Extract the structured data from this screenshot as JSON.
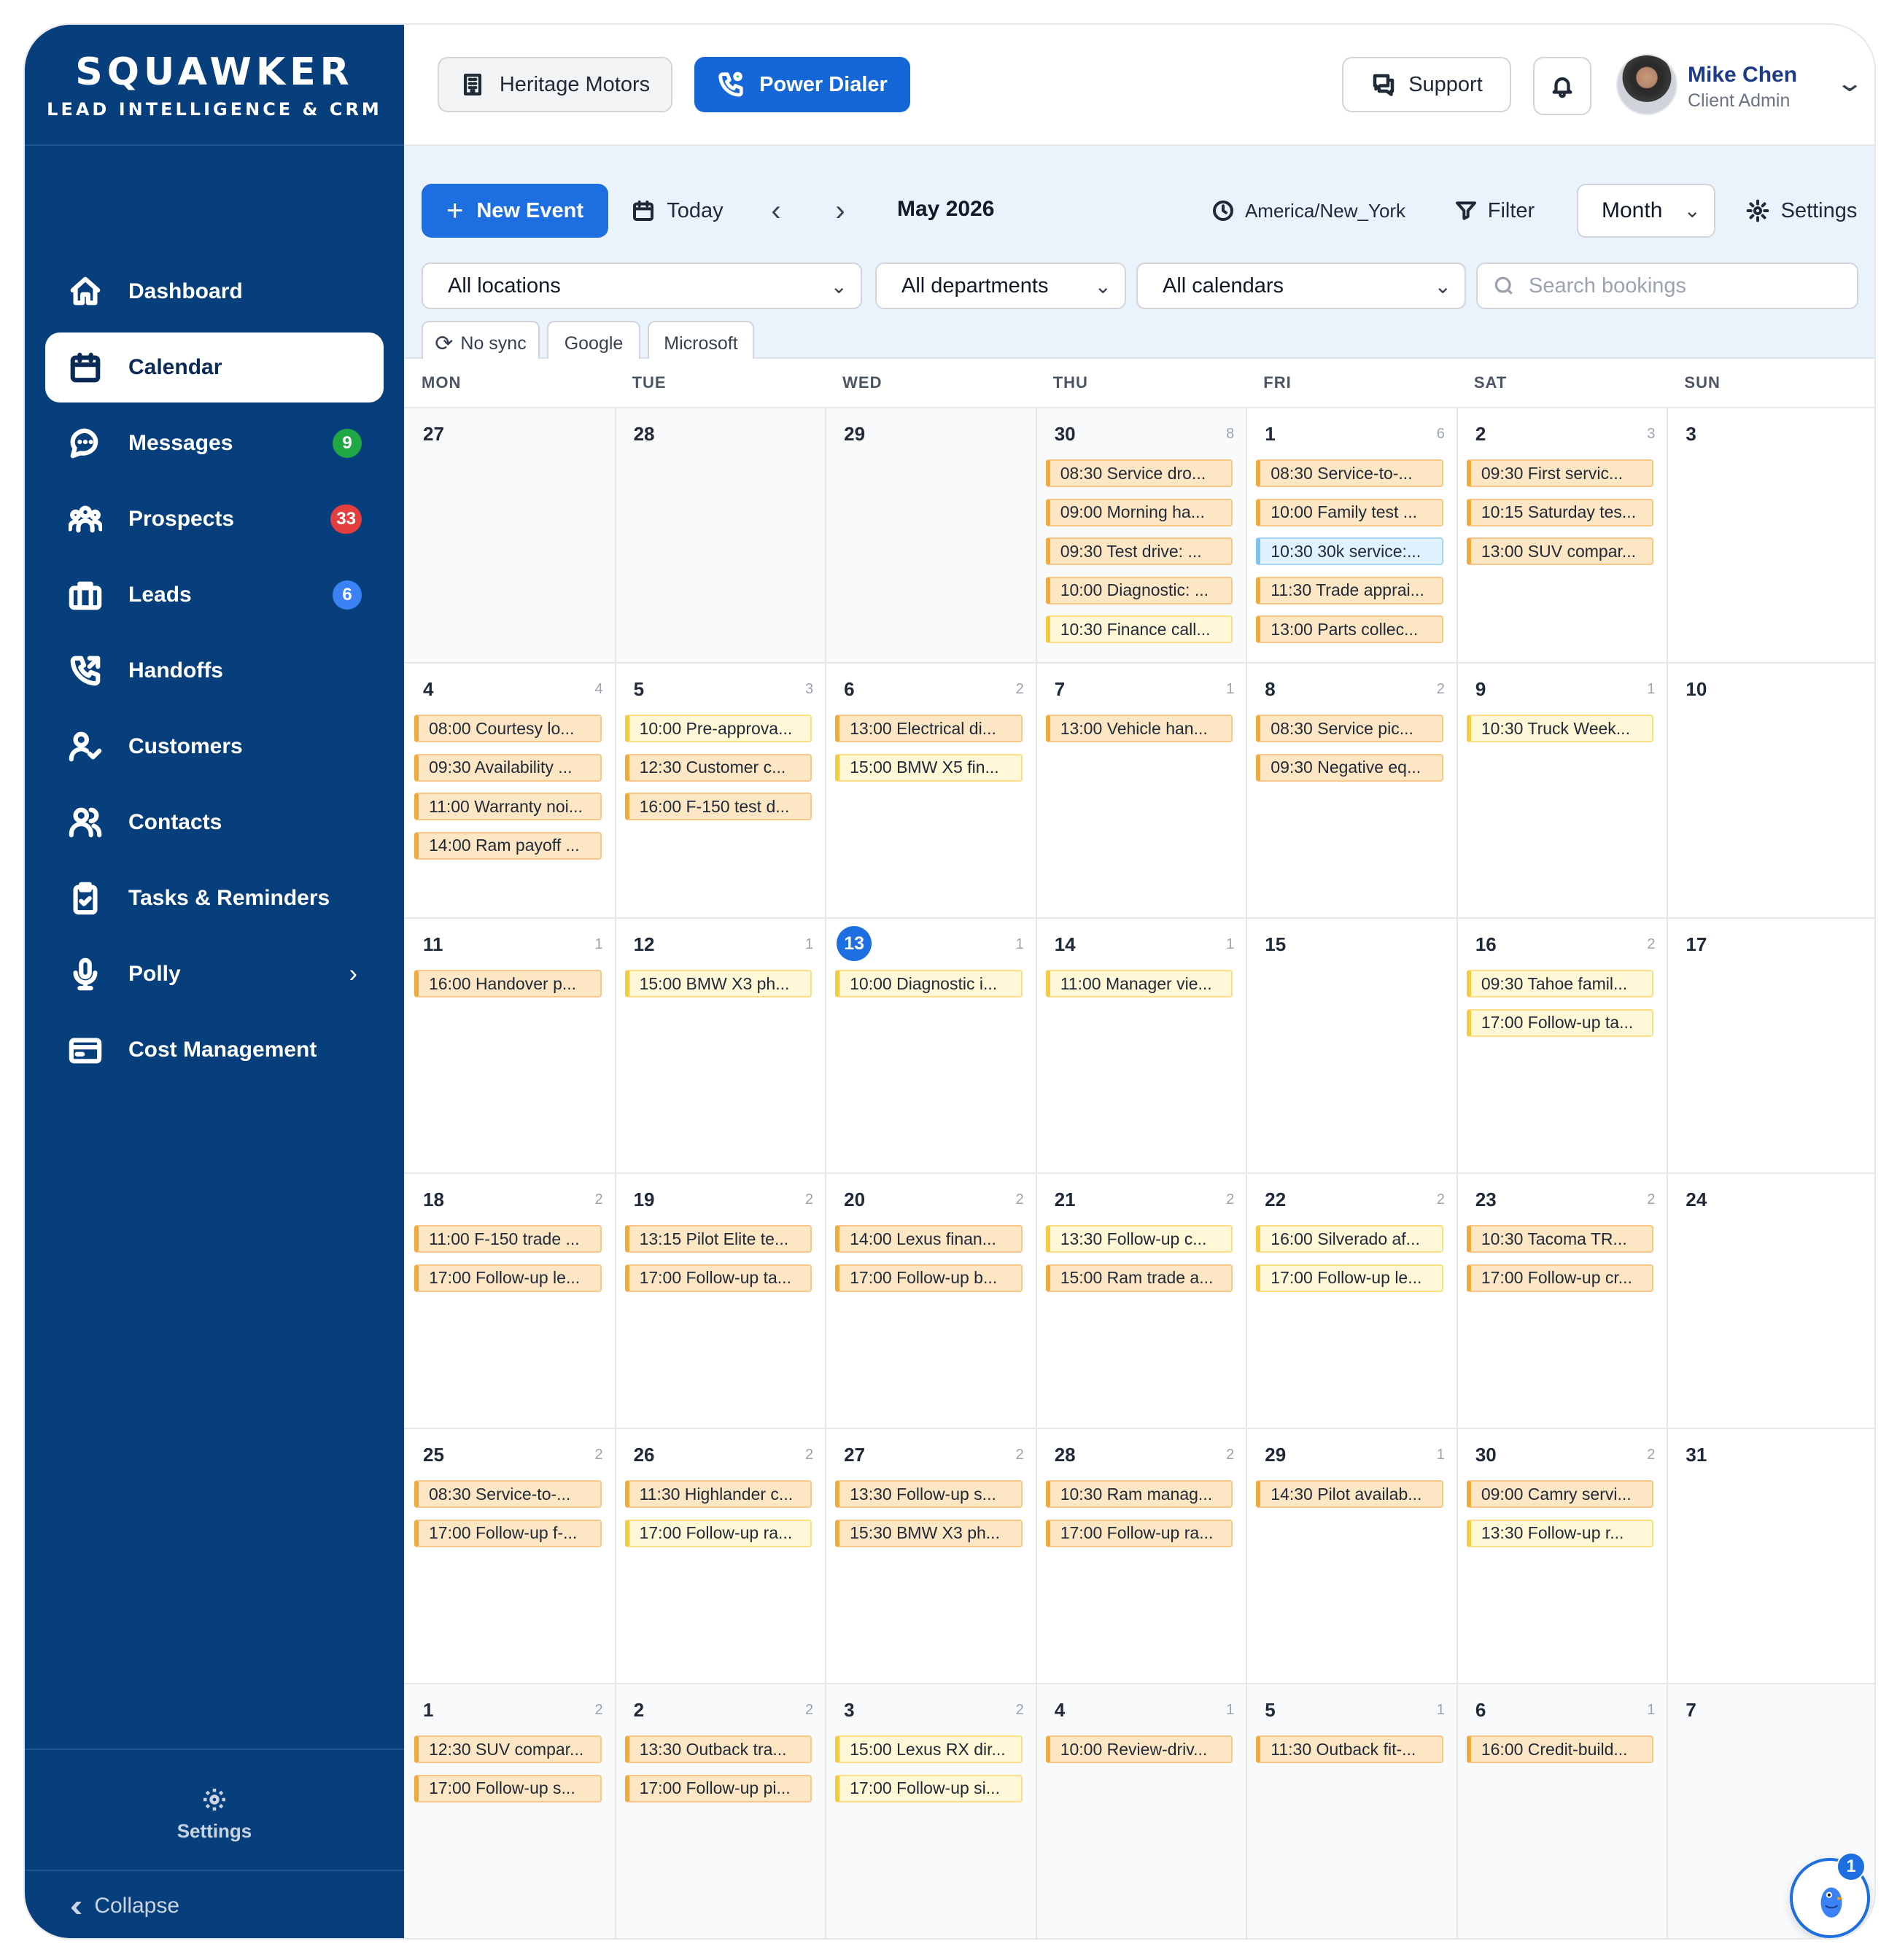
{
  "brand": {
    "title": "SQUAWKER",
    "subtitle": "LEAD INTELLIGENCE & CRM"
  },
  "sidebar": {
    "items": [
      {
        "label": "Dashboard",
        "icon": "home-icon"
      },
      {
        "label": "Calendar",
        "icon": "calendar-icon",
        "active": true
      },
      {
        "label": "Messages",
        "icon": "chat-icon",
        "badge": "9",
        "badge_color": "#22a745"
      },
      {
        "label": "Prospects",
        "icon": "users-group-icon",
        "badge": "33",
        "badge_color": "#e53e3e"
      },
      {
        "label": "Leads",
        "icon": "briefcase-icon",
        "badge": "6",
        "badge_color": "#3b82f6"
      },
      {
        "label": "Handoffs",
        "icon": "phone-forward-icon"
      },
      {
        "label": "Customers",
        "icon": "user-check-icon"
      },
      {
        "label": "Contacts",
        "icon": "users-icon"
      },
      {
        "label": "Tasks & Reminders",
        "icon": "clipboard-check-icon"
      },
      {
        "label": "Polly",
        "icon": "microphone-icon",
        "has_submenu": true
      },
      {
        "label": "Cost Management",
        "icon": "wallet-icon"
      }
    ],
    "settings_label": "Settings",
    "collapse_label": "Collapse"
  },
  "header": {
    "dealer": "Heritage Motors",
    "power_dialer": "Power Dialer",
    "support": "Support",
    "user_name": "Mike Chen",
    "user_role": "Client Admin"
  },
  "toolbar": {
    "new_event": "New Event",
    "today": "Today",
    "month_label": "May 2026",
    "timezone": "America/New_York",
    "filter": "Filter",
    "view": "Month",
    "settings": "Settings",
    "locations": "All locations",
    "departments": "All departments",
    "calendars": "All calendars",
    "search_placeholder": "Search bookings",
    "sync": [
      "No sync",
      "Google",
      "Microsoft"
    ]
  },
  "colors": {
    "sidebar": "#073e7c",
    "primary": "#1d6ee0",
    "event_orange": "#fde6c4",
    "event_yellow": "#fff7d6",
    "event_blue": "#e0f2fe"
  },
  "calendar": {
    "weekdays": [
      "MON",
      "TUE",
      "WED",
      "THU",
      "FRI",
      "SAT",
      "SUN"
    ],
    "weeks": [
      [
        {
          "day": "27",
          "other": true,
          "events": []
        },
        {
          "day": "28",
          "other": true,
          "events": []
        },
        {
          "day": "29",
          "other": true,
          "events": []
        },
        {
          "day": "30",
          "other": true,
          "count": "8",
          "events": [
            {
              "t": "08:30 Service dro..."
            },
            {
              "t": "09:00 Morning ha..."
            },
            {
              "t": "09:30 Test drive: ..."
            },
            {
              "t": "10:00 Diagnostic: ..."
            },
            {
              "t": "10:30 Finance call...",
              "c": "yellow"
            }
          ]
        },
        {
          "day": "1",
          "count": "6",
          "events": [
            {
              "t": "08:30 Service-to-..."
            },
            {
              "t": "10:00 Family test ..."
            },
            {
              "t": "10:30 30k service:...",
              "c": "blue"
            },
            {
              "t": "11:30 Trade apprai..."
            },
            {
              "t": "13:00 Parts collec..."
            }
          ]
        },
        {
          "day": "2",
          "count": "3",
          "events": [
            {
              "t": "09:30 First servic..."
            },
            {
              "t": "10:15 Saturday tes..."
            },
            {
              "t": "13:00 SUV compar..."
            }
          ]
        },
        {
          "day": "3",
          "events": []
        }
      ],
      [
        {
          "day": "4",
          "count": "4",
          "events": [
            {
              "t": "08:00 Courtesy lo..."
            },
            {
              "t": "09:30 Availability ..."
            },
            {
              "t": "11:00 Warranty noi..."
            },
            {
              "t": "14:00 Ram payoff ..."
            }
          ]
        },
        {
          "day": "5",
          "count": "3",
          "events": [
            {
              "t": "10:00 Pre-approva...",
              "c": "yellow"
            },
            {
              "t": "12:30 Customer c..."
            },
            {
              "t": "16:00 F-150 test d..."
            }
          ]
        },
        {
          "day": "6",
          "count": "2",
          "events": [
            {
              "t": "13:00 Electrical di..."
            },
            {
              "t": "15:00 BMW X5 fin...",
              "c": "yellow"
            }
          ]
        },
        {
          "day": "7",
          "count": "1",
          "events": [
            {
              "t": "13:00 Vehicle han..."
            }
          ]
        },
        {
          "day": "8",
          "count": "2",
          "events": [
            {
              "t": "08:30 Service pic..."
            },
            {
              "t": "09:30 Negative eq..."
            }
          ]
        },
        {
          "day": "9",
          "count": "1",
          "events": [
            {
              "t": "10:30 Truck Week...",
              "c": "yellow"
            }
          ]
        },
        {
          "day": "10",
          "events": []
        }
      ],
      [
        {
          "day": "11",
          "count": "1",
          "events": [
            {
              "t": "16:00 Handover p..."
            }
          ]
        },
        {
          "day": "12",
          "count": "1",
          "events": [
            {
              "t": "15:00 BMW X3 ph...",
              "c": "yellow"
            }
          ]
        },
        {
          "day": "13",
          "today": true,
          "count": "1",
          "events": [
            {
              "t": "10:00 Diagnostic i...",
              "c": "yellow"
            }
          ]
        },
        {
          "day": "14",
          "count": "1",
          "events": [
            {
              "t": "11:00 Manager vie...",
              "c": "yellow"
            }
          ]
        },
        {
          "day": "15",
          "events": []
        },
        {
          "day": "16",
          "count": "2",
          "events": [
            {
              "t": "09:30 Tahoe famil...",
              "c": "yellow"
            },
            {
              "t": "17:00 Follow-up ta...",
              "c": "yellow"
            }
          ]
        },
        {
          "day": "17",
          "events": []
        }
      ],
      [
        {
          "day": "18",
          "count": "2",
          "events": [
            {
              "t": "11:00 F-150 trade ..."
            },
            {
              "t": "17:00 Follow-up le..."
            }
          ]
        },
        {
          "day": "19",
          "count": "2",
          "events": [
            {
              "t": "13:15 Pilot Elite te..."
            },
            {
              "t": "17:00 Follow-up ta..."
            }
          ]
        },
        {
          "day": "20",
          "count": "2",
          "events": [
            {
              "t": "14:00 Lexus finan..."
            },
            {
              "t": "17:00 Follow-up b..."
            }
          ]
        },
        {
          "day": "21",
          "count": "2",
          "events": [
            {
              "t": "13:30 Follow-up c...",
              "c": "yellow"
            },
            {
              "t": "15:00 Ram trade a..."
            }
          ]
        },
        {
          "day": "22",
          "count": "2",
          "events": [
            {
              "t": "16:00 Silverado af...",
              "c": "yellow"
            },
            {
              "t": "17:00 Follow-up le...",
              "c": "yellow"
            }
          ]
        },
        {
          "day": "23",
          "count": "2",
          "events": [
            {
              "t": "10:30 Tacoma TR..."
            },
            {
              "t": "17:00 Follow-up cr..."
            }
          ]
        },
        {
          "day": "24",
          "events": []
        }
      ],
      [
        {
          "day": "25",
          "count": "2",
          "events": [
            {
              "t": "08:30 Service-to-..."
            },
            {
              "t": "17:00 Follow-up f-..."
            }
          ]
        },
        {
          "day": "26",
          "count": "2",
          "events": [
            {
              "t": "11:30 Highlander c..."
            },
            {
              "t": "17:00 Follow-up ra...",
              "c": "yellow"
            }
          ]
        },
        {
          "day": "27",
          "count": "2",
          "events": [
            {
              "t": "13:30 Follow-up s..."
            },
            {
              "t": "15:30 BMW X3 ph..."
            }
          ]
        },
        {
          "day": "28",
          "count": "2",
          "events": [
            {
              "t": "10:30 Ram manag..."
            },
            {
              "t": "17:00 Follow-up ra..."
            }
          ]
        },
        {
          "day": "29",
          "count": "1",
          "events": [
            {
              "t": "14:30 Pilot availab..."
            }
          ]
        },
        {
          "day": "30",
          "count": "2",
          "events": [
            {
              "t": "09:00 Camry servi..."
            },
            {
              "t": "13:30 Follow-up r...",
              "c": "yellow"
            }
          ]
        },
        {
          "day": "31",
          "events": []
        }
      ],
      [
        {
          "day": "1",
          "other": true,
          "count": "2",
          "events": [
            {
              "t": "12:30 SUV compar..."
            },
            {
              "t": "17:00 Follow-up s..."
            }
          ]
        },
        {
          "day": "2",
          "other": true,
          "count": "2",
          "events": [
            {
              "t": "13:30 Outback tra..."
            },
            {
              "t": "17:00 Follow-up pi..."
            }
          ]
        },
        {
          "day": "3",
          "other": true,
          "count": "2",
          "events": [
            {
              "t": "15:00 Lexus RX dir...",
              "c": "yellow"
            },
            {
              "t": "17:00 Follow-up si...",
              "c": "yellow"
            }
          ]
        },
        {
          "day": "4",
          "other": true,
          "count": "1",
          "events": [
            {
              "t": "10:00 Review-driv..."
            }
          ]
        },
        {
          "day": "5",
          "other": true,
          "count": "1",
          "events": [
            {
              "t": "11:30 Outback fit-..."
            }
          ]
        },
        {
          "day": "6",
          "other": true,
          "count": "1",
          "events": [
            {
              "t": "16:00 Credit-build..."
            }
          ]
        },
        {
          "day": "7",
          "other": true,
          "events": []
        }
      ]
    ]
  },
  "assistant": {
    "badge": "1",
    "icon": "bird-mascot-icon"
  }
}
